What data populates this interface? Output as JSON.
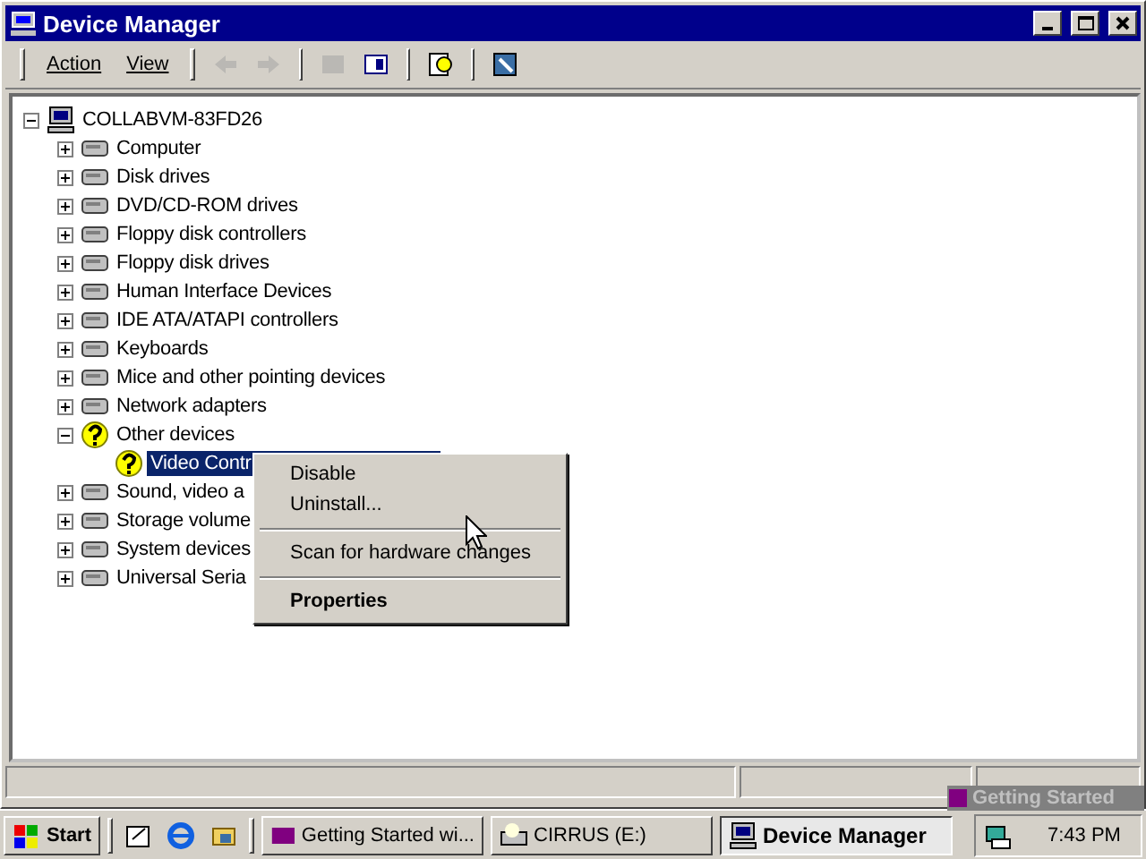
{
  "window": {
    "title": "Device Manager"
  },
  "menu": [
    {
      "label": "Action"
    },
    {
      "label": "View"
    }
  ],
  "toolbar": [
    {
      "disabled": true
    },
    {
      "disabled": true
    },
    {
      "disabled": true
    },
    {
      "disabled": false
    },
    {
      "disabled": false
    },
    {
      "disabled": false
    }
  ],
  "tree": {
    "label": "COLLABVM-83FD26",
    "kind": "computer",
    "expanded": true,
    "selected": false,
    "children": [
      {
        "label": "Computer",
        "kind": "device",
        "expanded": false,
        "selected": false
      },
      {
        "label": "Disk drives",
        "kind": "device",
        "expanded": false,
        "selected": false
      },
      {
        "label": "DVD/CD-ROM drives",
        "kind": "device",
        "expanded": false,
        "selected": false
      },
      {
        "label": "Floppy disk controllers",
        "kind": "device",
        "expanded": false,
        "selected": false
      },
      {
        "label": "Floppy disk drives",
        "kind": "device",
        "expanded": false,
        "selected": false
      },
      {
        "label": "Human Interface Devices",
        "kind": "device",
        "expanded": false,
        "selected": false
      },
      {
        "label": "IDE ATA/ATAPI controllers",
        "kind": "device",
        "expanded": false,
        "selected": false
      },
      {
        "label": "Keyboards",
        "kind": "device",
        "expanded": false,
        "selected": false
      },
      {
        "label": "Mice and other pointing devices",
        "kind": "device",
        "expanded": false,
        "selected": false
      },
      {
        "label": "Network adapters",
        "kind": "device",
        "expanded": false,
        "selected": false
      },
      {
        "label": "Other devices",
        "kind": "unknown",
        "expanded": true,
        "selected": false,
        "children": [
          {
            "label": "Video Contr",
            "kind": "unknown",
            "selected": true
          }
        ]
      },
      {
        "label": "Sound, video a",
        "kind": "device",
        "expanded": false,
        "selected": false
      },
      {
        "label": "Storage volume",
        "kind": "device",
        "expanded": false,
        "selected": false
      },
      {
        "label": "System devices",
        "kind": "device",
        "expanded": false,
        "selected": false
      },
      {
        "label": "Universal Seria",
        "kind": "device",
        "expanded": false,
        "selected": false
      }
    ]
  },
  "context_menu": [
    [
      {
        "label": "Disable",
        "default": false
      },
      {
        "label": "Uninstall...",
        "default": false
      }
    ],
    [
      {
        "label": "Scan for hardware changes",
        "default": false
      }
    ],
    [
      {
        "label": "Properties",
        "default": true
      }
    ]
  ],
  "popup": {
    "title": "Getting Started"
  },
  "taskbar": {
    "start": "Start",
    "tasks": [
      {
        "label": "Getting Started wi...",
        "selected": false
      },
      {
        "label": "CIRRUS (E:)",
        "selected": false
      },
      {
        "label": "Device Manager",
        "selected": true
      }
    ],
    "clock": "7:43 PM"
  }
}
